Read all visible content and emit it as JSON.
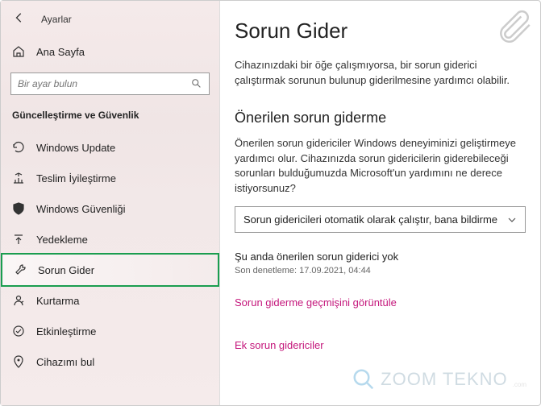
{
  "header": {
    "title": "Ayarlar"
  },
  "home": {
    "label": "Ana Sayfa"
  },
  "search": {
    "placeholder": "Bir ayar bulun"
  },
  "category": "Güncelleştirme ve Güvenlik",
  "nav": [
    {
      "label": "Windows Update"
    },
    {
      "label": "Teslim İyileştirme"
    },
    {
      "label": "Windows Güvenliği"
    },
    {
      "label": "Yedekleme"
    },
    {
      "label": "Sorun Gider"
    },
    {
      "label": "Kurtarma"
    },
    {
      "label": "Etkinleştirme"
    },
    {
      "label": "Cihazımı bul"
    }
  ],
  "page": {
    "title": "Sorun Gider",
    "intro": "Cihazınızdaki bir öğe çalışmıyorsa, bir sorun giderici çalıştırmak sorunun bulunup giderilmesine yardımcı olabilir.",
    "section_title": "Önerilen sorun giderme",
    "section_desc": "Önerilen sorun gidericiler Windows deneyiminizi geliştirmeye yardımcı olur. Cihazınızda sorun gidericilerin giderebileceği sorunları bulduğumuzda Microsoft'un yardımını ne derece istiyorsunuz?",
    "dropdown_value": "Sorun gidericileri otomatik olarak çalıştır, bana bildirme",
    "status": "Şu anda önerilen sorun giderici yok",
    "timestamp": "Son denetleme: 17.09.2021, 04:44",
    "link_history": "Sorun giderme geçmişini görüntüle",
    "link_extra": "Ek sorun gidericiler"
  },
  "watermark": {
    "text": "ZOOM TEKNO",
    "sub": ".com"
  }
}
